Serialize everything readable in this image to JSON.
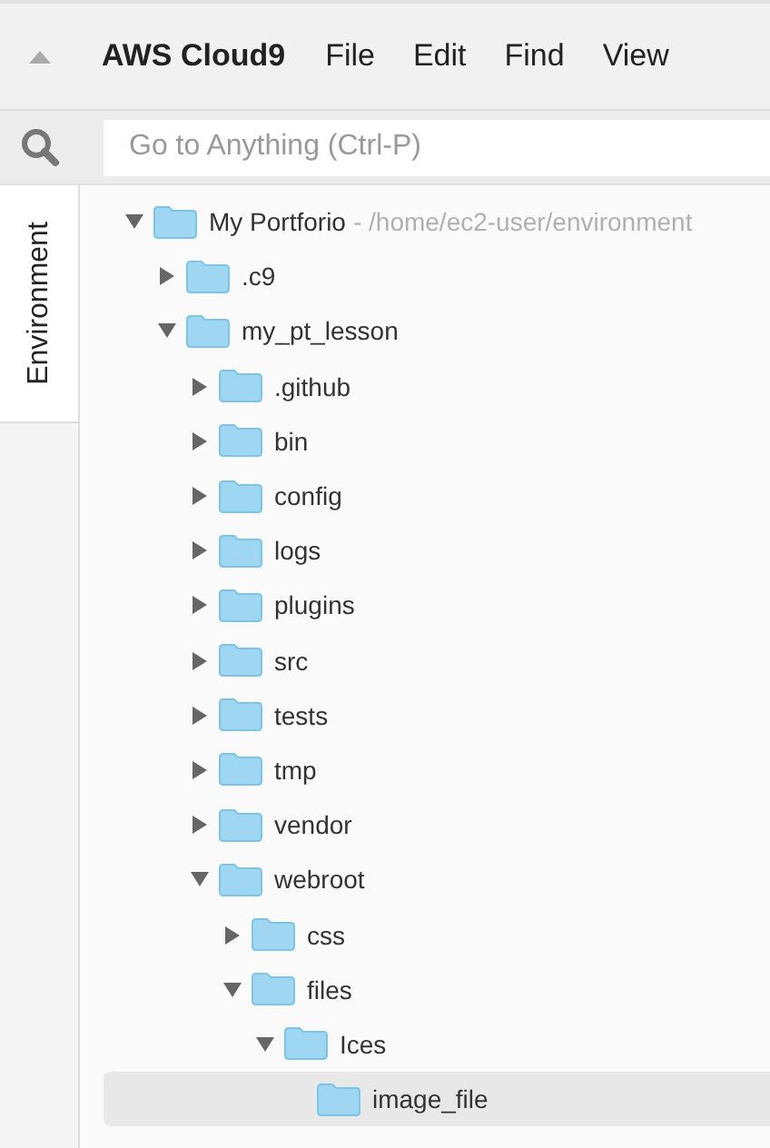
{
  "menu_bar": {
    "brand": "AWS Cloud9",
    "items": [
      "File",
      "Edit",
      "Find",
      "View"
    ]
  },
  "search": {
    "placeholder": "Go to Anything (Ctrl-P)"
  },
  "side_tabs": [
    {
      "label": "Environment",
      "selected": true
    }
  ],
  "tree": [
    {
      "name": "My Portforio",
      "path": "- /home/ec2-user/environment",
      "expandable": true,
      "expanded": true,
      "selected": false,
      "children": [
        {
          "name": ".c9",
          "expandable": true,
          "expanded": false,
          "selected": false
        },
        {
          "name": "my_pt_lesson",
          "expandable": true,
          "expanded": true,
          "selected": false,
          "children": [
            {
              "name": ".github",
              "expandable": true,
              "expanded": false,
              "selected": false
            },
            {
              "name": "bin",
              "expandable": true,
              "expanded": false,
              "selected": false
            },
            {
              "name": "config",
              "expandable": true,
              "expanded": false,
              "selected": false
            },
            {
              "name": "logs",
              "expandable": true,
              "expanded": false,
              "selected": false
            },
            {
              "name": "plugins",
              "expandable": true,
              "expanded": false,
              "selected": false
            },
            {
              "name": "src",
              "expandable": true,
              "expanded": false,
              "selected": false
            },
            {
              "name": "tests",
              "expandable": true,
              "expanded": false,
              "selected": false
            },
            {
              "name": "tmp",
              "expandable": true,
              "expanded": false,
              "selected": false
            },
            {
              "name": "vendor",
              "expandable": true,
              "expanded": false,
              "selected": false
            },
            {
              "name": "webroot",
              "expandable": true,
              "expanded": true,
              "selected": false,
              "children": [
                {
                  "name": "css",
                  "expandable": true,
                  "expanded": false,
                  "selected": false
                },
                {
                  "name": "files",
                  "expandable": true,
                  "expanded": true,
                  "selected": false,
                  "children": [
                    {
                      "name": "Ices",
                      "expandable": true,
                      "expanded": true,
                      "selected": false,
                      "children": [
                        {
                          "name": "image_file",
                          "expandable": false,
                          "expanded": false,
                          "selected": true
                        }
                      ]
                    }
                  ]
                }
              ]
            }
          ]
        }
      ]
    }
  ]
}
